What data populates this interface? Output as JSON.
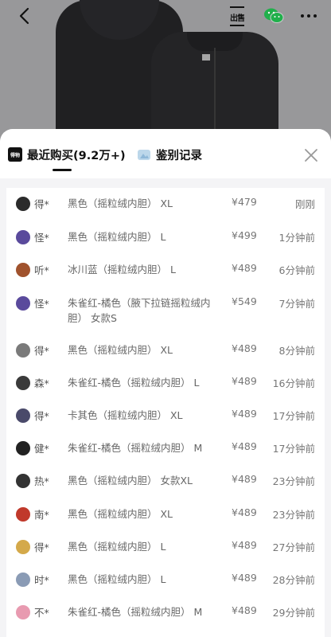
{
  "topbar": {
    "back_icon": "chevron-left-icon",
    "sell_label": "出售",
    "wechat_icon": "wechat-icon",
    "more_icon": "more-dots-icon"
  },
  "sheet": {
    "tabs": [
      {
        "label": "最近购买(9.2万+)",
        "logo_text": "得物",
        "active": true
      },
      {
        "label": "鉴别记录",
        "active": false
      }
    ],
    "close_icon": "close-icon"
  },
  "purchases": [
    {
      "user": "得*",
      "product": "黑色（摇粒绒内胆） XL",
      "price": "¥479",
      "time": "刚刚",
      "avatar_color": "#2b2b2b"
    },
    {
      "user": "怪*",
      "product": "黑色（摇粒绒内胆） L",
      "price": "¥499",
      "time": "1分钟前",
      "avatar_color": "#5a4a9c"
    },
    {
      "user": "听*",
      "product": "冰川蓝（摇粒绒内胆） L",
      "price": "¥489",
      "time": "6分钟前",
      "avatar_color": "#a0522d"
    },
    {
      "user": "怪*",
      "product": "朱雀红-橘色（腋下拉链摇粒绒内胆） 女款S",
      "price": "¥549",
      "time": "7分钟前",
      "avatar_color": "#5a4a9c"
    },
    {
      "user": "得*",
      "product": "黑色（摇粒绒内胆） XL",
      "price": "¥489",
      "time": "8分钟前",
      "avatar_color": "#7a7a7a"
    },
    {
      "user": "森*",
      "product": "朱雀红-橘色（摇粒绒内胆） L",
      "price": "¥489",
      "time": "16分钟前",
      "avatar_color": "#3a3a3a"
    },
    {
      "user": "得*",
      "product": "卡其色（摇粒绒内胆） XL",
      "price": "¥489",
      "time": "17分钟前",
      "avatar_color": "#4a4a6a"
    },
    {
      "user": "健*",
      "product": "朱雀红-橘色（摇粒绒内胆） M",
      "price": "¥489",
      "time": "17分钟前",
      "avatar_color": "#222222"
    },
    {
      "user": "热*",
      "product": "黑色（摇粒绒内胆） 女款XL",
      "price": "¥489",
      "time": "23分钟前",
      "avatar_color": "#333333"
    },
    {
      "user": "南*",
      "product": "黑色（摇粒绒内胆） XL",
      "price": "¥489",
      "time": "23分钟前",
      "avatar_color": "#c0392b"
    },
    {
      "user": "得*",
      "product": "黑色（摇粒绒内胆） L",
      "price": "¥489",
      "time": "27分钟前",
      "avatar_color": "#d4a94a"
    },
    {
      "user": "时*",
      "product": "黑色（摇粒绒内胆） L",
      "price": "¥489",
      "time": "28分钟前",
      "avatar_color": "#8a9bb5"
    },
    {
      "user": "不*",
      "product": "朱雀红-橘色（摇粒绒内胆） M",
      "price": "¥489",
      "time": "29分钟前",
      "avatar_color": "#e89ab0"
    }
  ]
}
